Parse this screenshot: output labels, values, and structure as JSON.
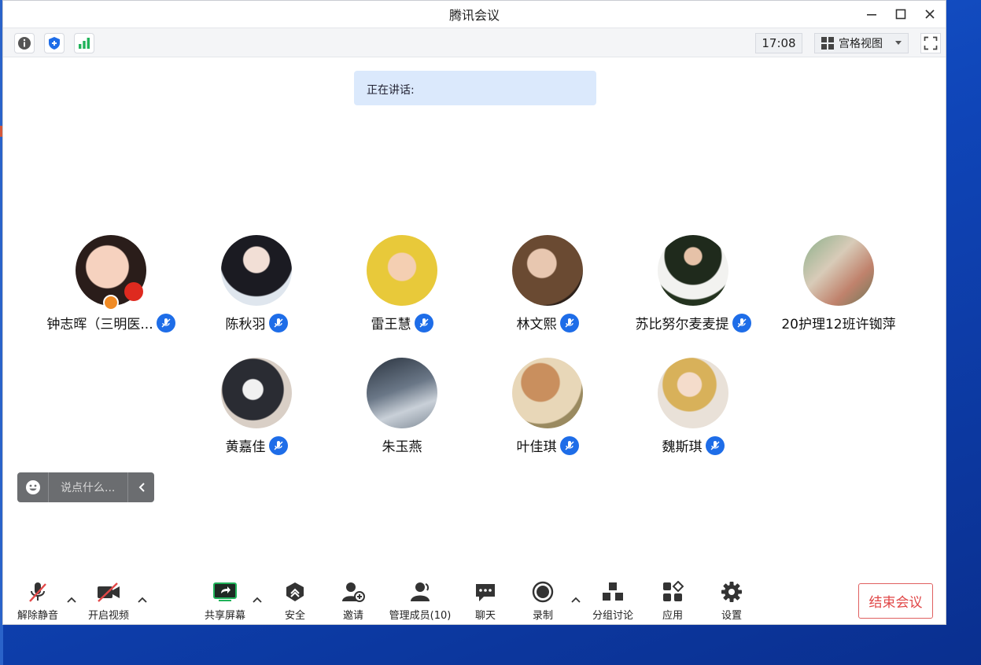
{
  "window": {
    "title": "腾讯会议"
  },
  "top_toolbar": {
    "info_icon": "info-icon",
    "security_icon": "shield-plus-icon",
    "signal_icon": "signal-bars-icon",
    "time": "17:08",
    "view_label": "宫格视图"
  },
  "speaking": {
    "label": "正在讲话:"
  },
  "participants": [
    {
      "name": "钟志晖（三明医...",
      "muted": true,
      "host": true
    },
    {
      "name": "陈秋羽",
      "muted": true
    },
    {
      "name": "雷王慧",
      "muted": true
    },
    {
      "name": "林文熙",
      "muted": true
    },
    {
      "name": "苏比努尔麦麦提",
      "muted": true
    },
    {
      "name": "20护理12班许铷萍",
      "muted": false
    },
    {
      "name": "黄嘉佳",
      "muted": true
    },
    {
      "name": "朱玉燕",
      "muted": false
    },
    {
      "name": "叶佳琪",
      "muted": true
    },
    {
      "name": "魏斯琪",
      "muted": true
    }
  ],
  "chat": {
    "placeholder": "说点什么..."
  },
  "bottom_toolbar": {
    "unmute": "解除静音",
    "start_video": "开启视频",
    "share_screen": "共享屏幕",
    "security": "安全",
    "invite": "邀请",
    "manage_members": "管理成员(10)",
    "chat": "聊天",
    "record": "录制",
    "breakout": "分组讨论",
    "apps": "应用",
    "settings": "设置",
    "end_meeting": "结束会议"
  },
  "colors": {
    "accent": "#1e6de8",
    "end_red": "#e04646",
    "speaking_bg": "#dbe9fc"
  }
}
